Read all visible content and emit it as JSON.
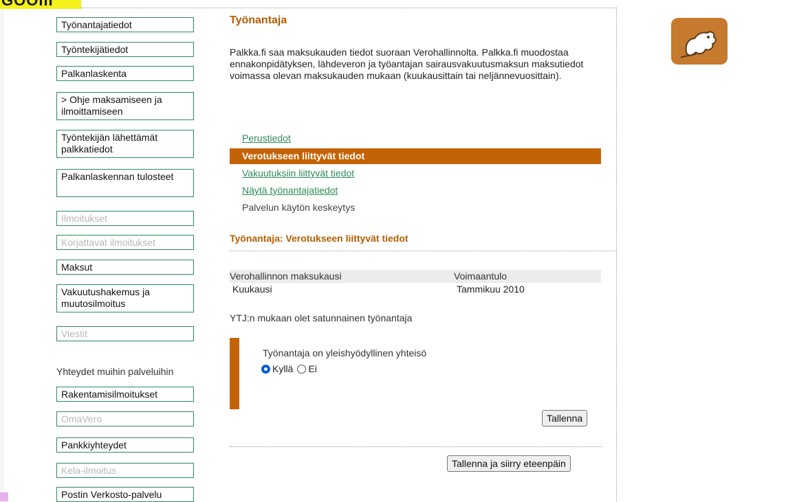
{
  "top_fragment": "GOOIII",
  "sidebar": {
    "items": [
      {
        "label": "Työnantajatiedot",
        "enabled": true
      },
      {
        "label": "Työntekijätiedot",
        "enabled": true
      },
      {
        "label": "Palkanlaskenta",
        "enabled": true
      },
      {
        "label": "> Ohje maksamiseen ja ilmoittamiseen",
        "enabled": true
      },
      {
        "label": "Työntekijän lähettämät palkkatiedot",
        "enabled": true
      },
      {
        "label": "Palkanlaskennan tulosteet",
        "enabled": true
      },
      {
        "label": "Ilmoitukset",
        "enabled": false
      },
      {
        "label": "Korjattavat ilmoitukset",
        "enabled": false
      },
      {
        "label": "Maksut",
        "enabled": true
      },
      {
        "label": "Vakuutushakemus ja muutosilmoitus",
        "enabled": true
      },
      {
        "label": "Viestit",
        "enabled": false
      }
    ],
    "section_heading": "Yhteydet muihin palveluihin",
    "links": [
      {
        "label": "Rakentamisilmoitukset",
        "enabled": true
      },
      {
        "label": "OmaVero",
        "enabled": false
      },
      {
        "label": "Pankkiyhteydet",
        "enabled": true
      },
      {
        "label": "Kela-ilmoitus",
        "enabled": false
      },
      {
        "label": "Postin Verkosto-palvelu",
        "enabled": true
      }
    ]
  },
  "main": {
    "title": "Työnantaja",
    "intro": "Palkka.fi saa maksukauden tiedot suoraan Verohallinnolta. Palkka.fi muodostaa ennakonpidätyksen, lähdeveron ja työantajan sairausvakuutusmaksun maksutiedot voimassa olevan maksukauden mukaan (kuukausittain tai neljännevuosittain).",
    "tabs": [
      {
        "label": "Perustiedot",
        "state": "link"
      },
      {
        "label": "Verotukseen liittyvät tiedot",
        "state": "active"
      },
      {
        "label": "Vakuutuksiin liittyvät tiedot",
        "state": "link"
      },
      {
        "label": "Näytä työnantajatiedot",
        "state": "link"
      },
      {
        "label": "Palvelun käytön keskeytys",
        "state": "plain"
      }
    ],
    "section_title": "Työnantaja: Verotukseen liittyvät tiedot",
    "table": {
      "headers": [
        "Verohallinnon maksukausi",
        "Voimaantulo"
      ],
      "row": [
        "Kuukausi",
        "Tammikuu 2010"
      ]
    },
    "ytj_note": "YTJ:n mukaan olet satunnainen työnantaja",
    "question": "Työnantaja on yleishyödyllinen yhteisö",
    "options": [
      {
        "label": "Kyllä",
        "checked": true
      },
      {
        "label": "Ei",
        "checked": false
      }
    ],
    "save_button": "Tallenna",
    "save_next_button": "Tallenna ja siirry eteenpäin"
  },
  "colors": {
    "accent_orange": "#c46305",
    "title_orange": "#b85c00",
    "link_green": "#2e8b57",
    "disabled_gray": "#b8b8b8",
    "radio_blue": "#0a5bd3"
  },
  "logo_icon": "cartoon-figure-logo-icon"
}
